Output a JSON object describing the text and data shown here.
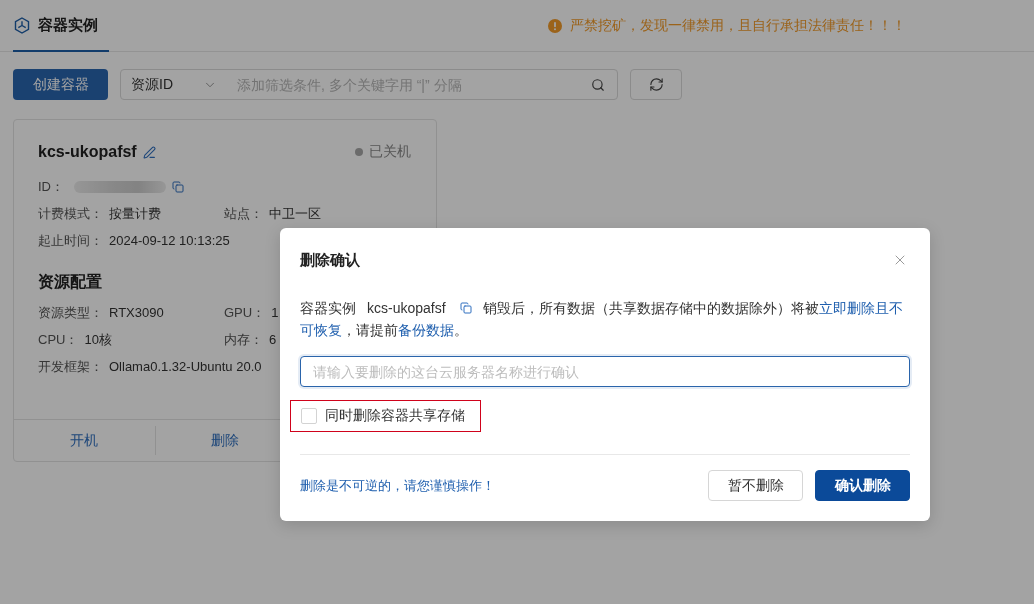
{
  "header": {
    "tab": {
      "label": "容器实例",
      "selected": true
    },
    "notice": "严禁挖矿，发现一律禁用，且自行承担法律责任！！！"
  },
  "toolbar": {
    "create_button": "创建容器",
    "filter": {
      "field": "资源ID",
      "placeholder": "添加筛选条件, 多个关键字用 “|” 分隔"
    }
  },
  "instance_card": {
    "name": "kcs-ukopafsf",
    "status": {
      "label": "已关机",
      "running": false
    },
    "id_label": "ID：",
    "details": [
      {
        "fields": [
          {
            "label": "计费模式：",
            "value": "按量计费"
          },
          {
            "label": "站点：",
            "value": "中卫一区"
          }
        ]
      },
      {
        "fields": [
          {
            "label": "起止时间：",
            "value": "2024-09-12 10:13:25"
          }
        ]
      }
    ],
    "section_title": "资源配置",
    "resources": [
      {
        "fields": [
          {
            "label": "资源类型：",
            "value": "RTX3090"
          },
          {
            "label": "GPU：",
            "value": "1"
          }
        ]
      },
      {
        "fields": [
          {
            "label": "CPU：",
            "value": "10核"
          },
          {
            "label": "内存：",
            "value": "6"
          }
        ]
      },
      {
        "fields": [
          {
            "label": "开发框架：",
            "value": "Ollama0.1.32-Ubuntu 20.0"
          }
        ]
      }
    ],
    "actions": [
      "开机",
      "删除"
    ]
  },
  "dialog": {
    "title": "删除确认",
    "message": {
      "label": "容器实例",
      "instance_name": "kcs-ukopafsf",
      "segments": [
        {
          "kind": "plain",
          "text": "销毁后，所有数据（共享数据存储中的数据除外）将被"
        },
        {
          "kind": "emphasis",
          "text": "立即删除且不可恢复"
        },
        {
          "kind": "plain",
          "text": "，请提前"
        },
        {
          "kind": "emphasis",
          "text": "备份数据"
        },
        {
          "kind": "plain",
          "text": "。"
        }
      ]
    },
    "input": {
      "placeholder": "请输入要删除的这台云服务器名称进行确认",
      "focused": true
    },
    "option": {
      "label": "同时删除容器共享存储",
      "checked": false,
      "highlighted": true
    },
    "note": "删除是不可逆的，请您谨慎操作！",
    "buttons": [
      {
        "label": "暂不删除",
        "kind": "secondary"
      },
      {
        "label": "确认删除",
        "kind": "primary"
      }
    ]
  }
}
